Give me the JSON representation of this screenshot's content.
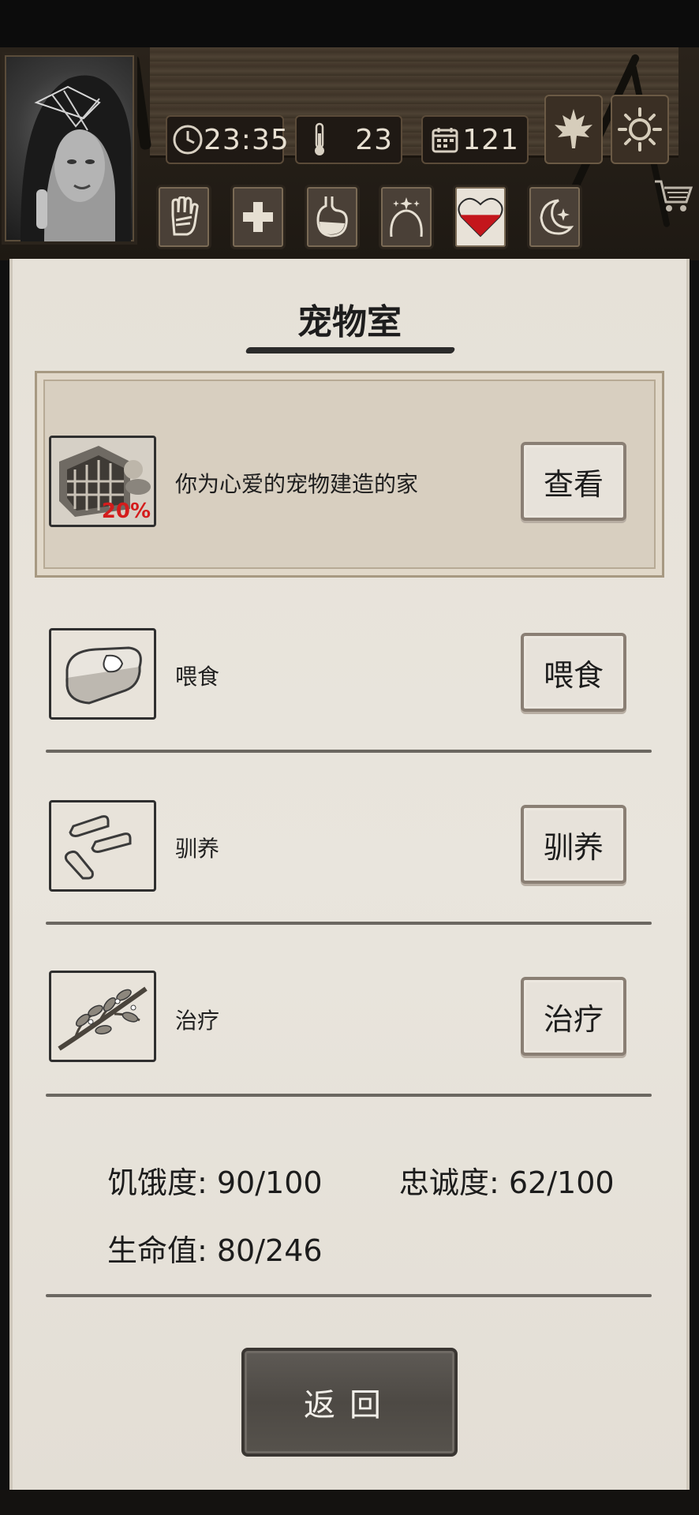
{
  "hud": {
    "time": "23:35",
    "temperature": "23",
    "day": "121",
    "season_icon": "maple-leaf-icon",
    "weather_icon": "sun-icon",
    "status_icons": [
      "hand-icon",
      "health-cross-icon",
      "stomach-icon",
      "head-sparkle-icon",
      "heart-icon",
      "moon-star-icon"
    ],
    "heart_fill_fraction": 0.55
  },
  "page": {
    "title": "宠物室"
  },
  "featured": {
    "description": "你为心爱的宠物建造的家",
    "progress": "20%",
    "button": "查看"
  },
  "actions": [
    {
      "label": "喂食",
      "button": "喂食",
      "icon": "meat-icon"
    },
    {
      "label": "驯养",
      "button": "驯养",
      "icon": "bone-icon"
    },
    {
      "label": "治疗",
      "button": "治疗",
      "icon": "herb-icon"
    }
  ],
  "stats": {
    "hunger": "饥饿度: 90/100",
    "loyalty": "忠诚度: 62/100",
    "health": "生命值: 80/246"
  },
  "back_button": "返回",
  "colors": {
    "progress_red": "#d41c1c",
    "heart_red": "#c4161c",
    "paper": "#e7e2d9"
  }
}
